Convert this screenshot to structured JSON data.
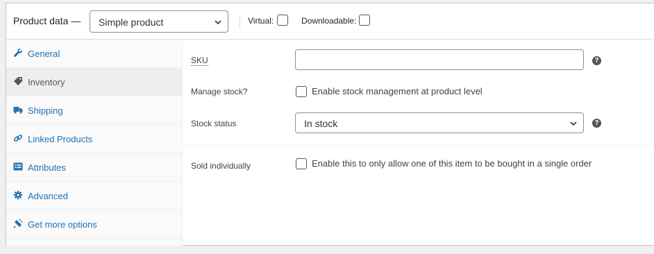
{
  "header": {
    "title": "Product data —",
    "product_type": "Simple product",
    "virtual_label": "Virtual:",
    "downloadable_label": "Downloadable:"
  },
  "tabs": [
    {
      "label": "General",
      "icon": "wrench-icon",
      "active": false
    },
    {
      "label": "Inventory",
      "icon": "tag-icon",
      "active": true
    },
    {
      "label": "Shipping",
      "icon": "truck-icon",
      "active": false
    },
    {
      "label": "Linked Products",
      "icon": "link-icon",
      "active": false
    },
    {
      "label": "Attributes",
      "icon": "list-icon",
      "active": false
    },
    {
      "label": "Advanced",
      "icon": "gear-icon",
      "active": false
    },
    {
      "label": "Get more options",
      "icon": "plugin-icon",
      "active": false
    }
  ],
  "inventory": {
    "sku_label": "SKU",
    "sku_value": "",
    "manage_stock_label": "Manage stock?",
    "manage_stock_text": "Enable stock management at product level",
    "stock_status_label": "Stock status",
    "stock_status_value": "In stock",
    "sold_individually_label": "Sold individually",
    "sold_individually_text": "Enable this to only allow one of this item to be bought in a single order",
    "help_glyph": "?"
  },
  "colors": {
    "link": "#2271b1",
    "active_tab_bg": "#eeeeee",
    "help_bg": "#50575e"
  }
}
